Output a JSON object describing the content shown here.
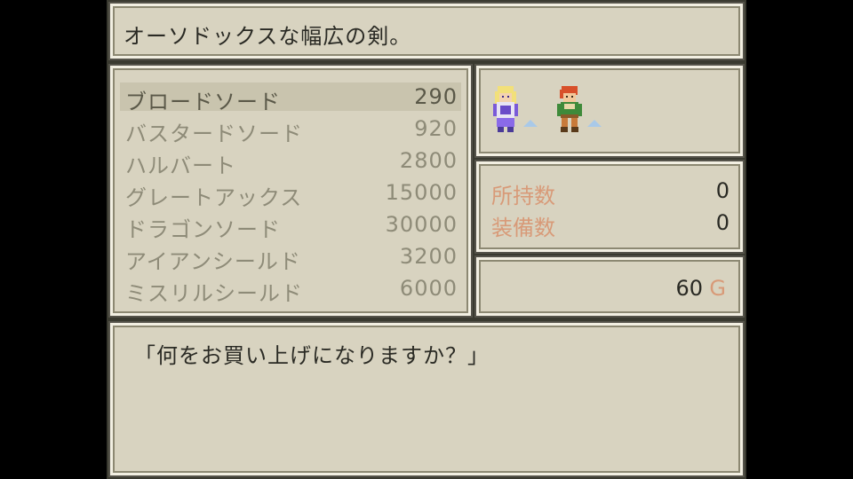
{
  "description": "オーソドックスな幅広の剣。",
  "items": [
    {
      "name": "ブロードソード",
      "price": "290"
    },
    {
      "name": "バスタードソード",
      "price": "920"
    },
    {
      "name": "ハルバート",
      "price": "2800"
    },
    {
      "name": "グレートアックス",
      "price": "15000"
    },
    {
      "name": "ドラゴンソード",
      "price": "30000"
    },
    {
      "name": "アイアンシールド",
      "price": "3200"
    },
    {
      "name": "ミスリルシールド",
      "price": "6000"
    }
  ],
  "selected_index": 0,
  "counts": {
    "owned_label": "所持数",
    "owned_value": "0",
    "equipped_label": "装備数",
    "equipped_value": "0"
  },
  "gold": {
    "amount": "60",
    "unit": "G"
  },
  "dialog": "「何をお買い上げになりますか？」",
  "colors": {
    "panel": "#d8d3c0",
    "highlight": "#c9c4ae",
    "label_orange": "#d89a78"
  }
}
